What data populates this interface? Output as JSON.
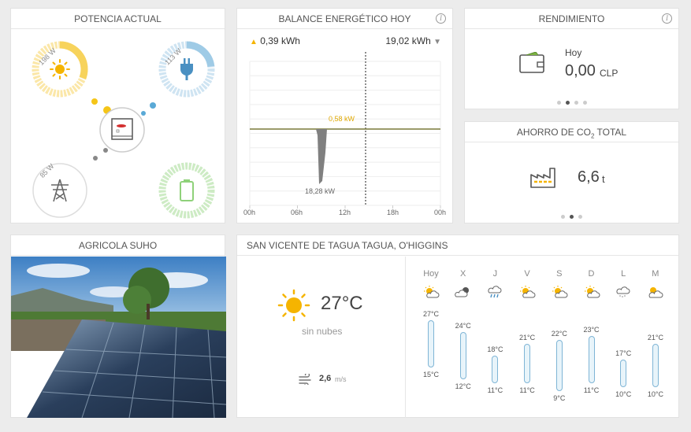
{
  "potencia": {
    "title": "POTENCIA ACTUAL",
    "solar_value": "198 W",
    "grid_feed_value": "113 W",
    "grid_value": "85 W"
  },
  "balance": {
    "title": "BALANCE ENERGÉTICO HOY",
    "up_value": "0,39 kWh",
    "down_value": "19,02 kWh",
    "peak_label": "0,58 kW",
    "min_label": "18,28 kW",
    "x_ticks": [
      "00h",
      "06h",
      "12h",
      "18h",
      "00h"
    ],
    "colors": {
      "up": "#f5b400",
      "down": "#888888"
    }
  },
  "chart_data": {
    "type": "area",
    "x": [
      "00h",
      "06h",
      "12h",
      "18h",
      "00h"
    ],
    "series": [
      {
        "values_kw": [
          0,
          0,
          0.58,
          0,
          0
        ]
      },
      {
        "values_kw": [
          0,
          0,
          -18.28,
          0,
          0
        ]
      }
    ],
    "annotations": [
      "0,58 kW",
      "18,28 kW"
    ]
  },
  "rendimiento": {
    "title": "RENDIMIENTO",
    "period": "Hoy",
    "value": "0,00",
    "unit": "CLP",
    "dots_count": 4,
    "active_dot": 1
  },
  "ahorro": {
    "title_prefix": "AHORRO DE CO",
    "title_sub": "2",
    "title_suffix": " TOTAL",
    "value": "6,6",
    "unit": "t",
    "dots_count": 3,
    "active_dot": 1
  },
  "site": {
    "title": "AGRICOLA SUHO"
  },
  "weather": {
    "title": "SAN VICENTE DE TAGUA TAGUA, O'HIGGINS",
    "current_temp": "27°C",
    "condition": "sin nubes",
    "wind_value": "2,6",
    "wind_unit": "m/s",
    "days": [
      {
        "day": "Hoy",
        "icon": "partly-sunny-icon",
        "max": "27°C",
        "min": "15°C"
      },
      {
        "day": "X",
        "icon": "cloud-sun-icon",
        "max": "24°C",
        "min": "12°C"
      },
      {
        "day": "J",
        "icon": "rain-icon",
        "max": "18°C",
        "min": "11°C"
      },
      {
        "day": "V",
        "icon": "partly-sunny-icon",
        "max": "21°C",
        "min": "11°C"
      },
      {
        "day": "S",
        "icon": "partly-sunny-icon",
        "max": "22°C",
        "min": "9°C"
      },
      {
        "day": "D",
        "icon": "partly-sunny-icon",
        "max": "23°C",
        "min": "11°C"
      },
      {
        "day": "L",
        "icon": "cloud-drizzle-icon",
        "max": "17°C",
        "min": "10°C"
      },
      {
        "day": "M",
        "icon": "partly-cloudy-icon",
        "max": "21°C",
        "min": "10°C"
      }
    ]
  }
}
